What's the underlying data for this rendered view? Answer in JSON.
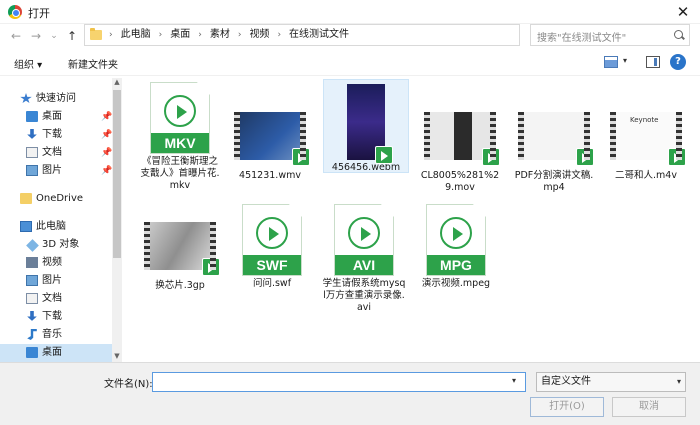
{
  "window": {
    "title": "打开",
    "close_glyph": "✕"
  },
  "nav": {
    "back": "←",
    "forward": "→",
    "recent": "⌄",
    "up": "↑",
    "breadcrumbs": [
      "此电脑",
      "桌面",
      "素材",
      "视频",
      "在线测试文件"
    ],
    "separator": "›",
    "dropdown": "⌄",
    "refresh": "↻",
    "search_placeholder": "搜索\"在线测试文件\""
  },
  "toolbar": {
    "organize": "组织 ▾",
    "new_folder": "新建文件夹",
    "view_dd": "▾",
    "help": "?"
  },
  "sidebar": {
    "items": [
      {
        "label": "快速访问",
        "icon": "star-icon",
        "pinned": false
      },
      {
        "label": "桌面",
        "icon": "desktop-icon",
        "pinned": true
      },
      {
        "label": "下载",
        "icon": "download-icon",
        "pinned": true
      },
      {
        "label": "文档",
        "icon": "document-icon",
        "pinned": true
      },
      {
        "label": "图片",
        "icon": "picture-icon",
        "pinned": true
      },
      {
        "label": "OneDrive",
        "icon": "folder-icon",
        "pinned": false
      },
      {
        "label": "此电脑",
        "icon": "computer-icon",
        "pinned": false
      },
      {
        "label": "3D 对象",
        "icon": "3d-objects-icon",
        "pinned": false
      },
      {
        "label": "视频",
        "icon": "video-icon",
        "pinned": false
      },
      {
        "label": "图片",
        "icon": "picture-icon",
        "pinned": false
      },
      {
        "label": "文档",
        "icon": "document-icon",
        "pinned": false
      },
      {
        "label": "下载",
        "icon": "download-icon",
        "pinned": false
      },
      {
        "label": "音乐",
        "icon": "music-icon",
        "pinned": false
      },
      {
        "label": "桌面",
        "icon": "desktop-icon",
        "pinned": false
      }
    ],
    "pin_glyph": "📌"
  },
  "files": [
    {
      "name": "《冒险王衡斯理之支戬人》首曝片花.mkv",
      "kind": "doc",
      "badge": "MKV"
    },
    {
      "name": "451231.wmv",
      "kind": "thumb"
    },
    {
      "name": "456456.webm",
      "kind": "portrait"
    },
    {
      "name": "CL8005%281%29.mov",
      "kind": "thumb"
    },
    {
      "name": "PDF分割演讲文稿.mp4",
      "kind": "thumb"
    },
    {
      "name": "二哥和人.m4v",
      "kind": "thumb",
      "thumb_text": "Keynote"
    },
    {
      "name": "换芯片.3gp",
      "kind": "thumb"
    },
    {
      "name": "问问.swf",
      "kind": "doc",
      "badge": "SWF"
    },
    {
      "name": "学生请假系统mysql万方查重演示录像.avi",
      "kind": "doc",
      "badge": "AVI"
    },
    {
      "name": "演示视频.mpeg",
      "kind": "doc",
      "badge": "MPG"
    }
  ],
  "bottom": {
    "filename_label": "文件名(N):",
    "filename_value": "",
    "filetype": "自定义文件",
    "open_button": "打开(O)",
    "cancel_button": "取消"
  },
  "colors": {
    "accent_green": "#2da24a",
    "selection": "#cde4f7",
    "link_blue": "#2a74c9"
  }
}
